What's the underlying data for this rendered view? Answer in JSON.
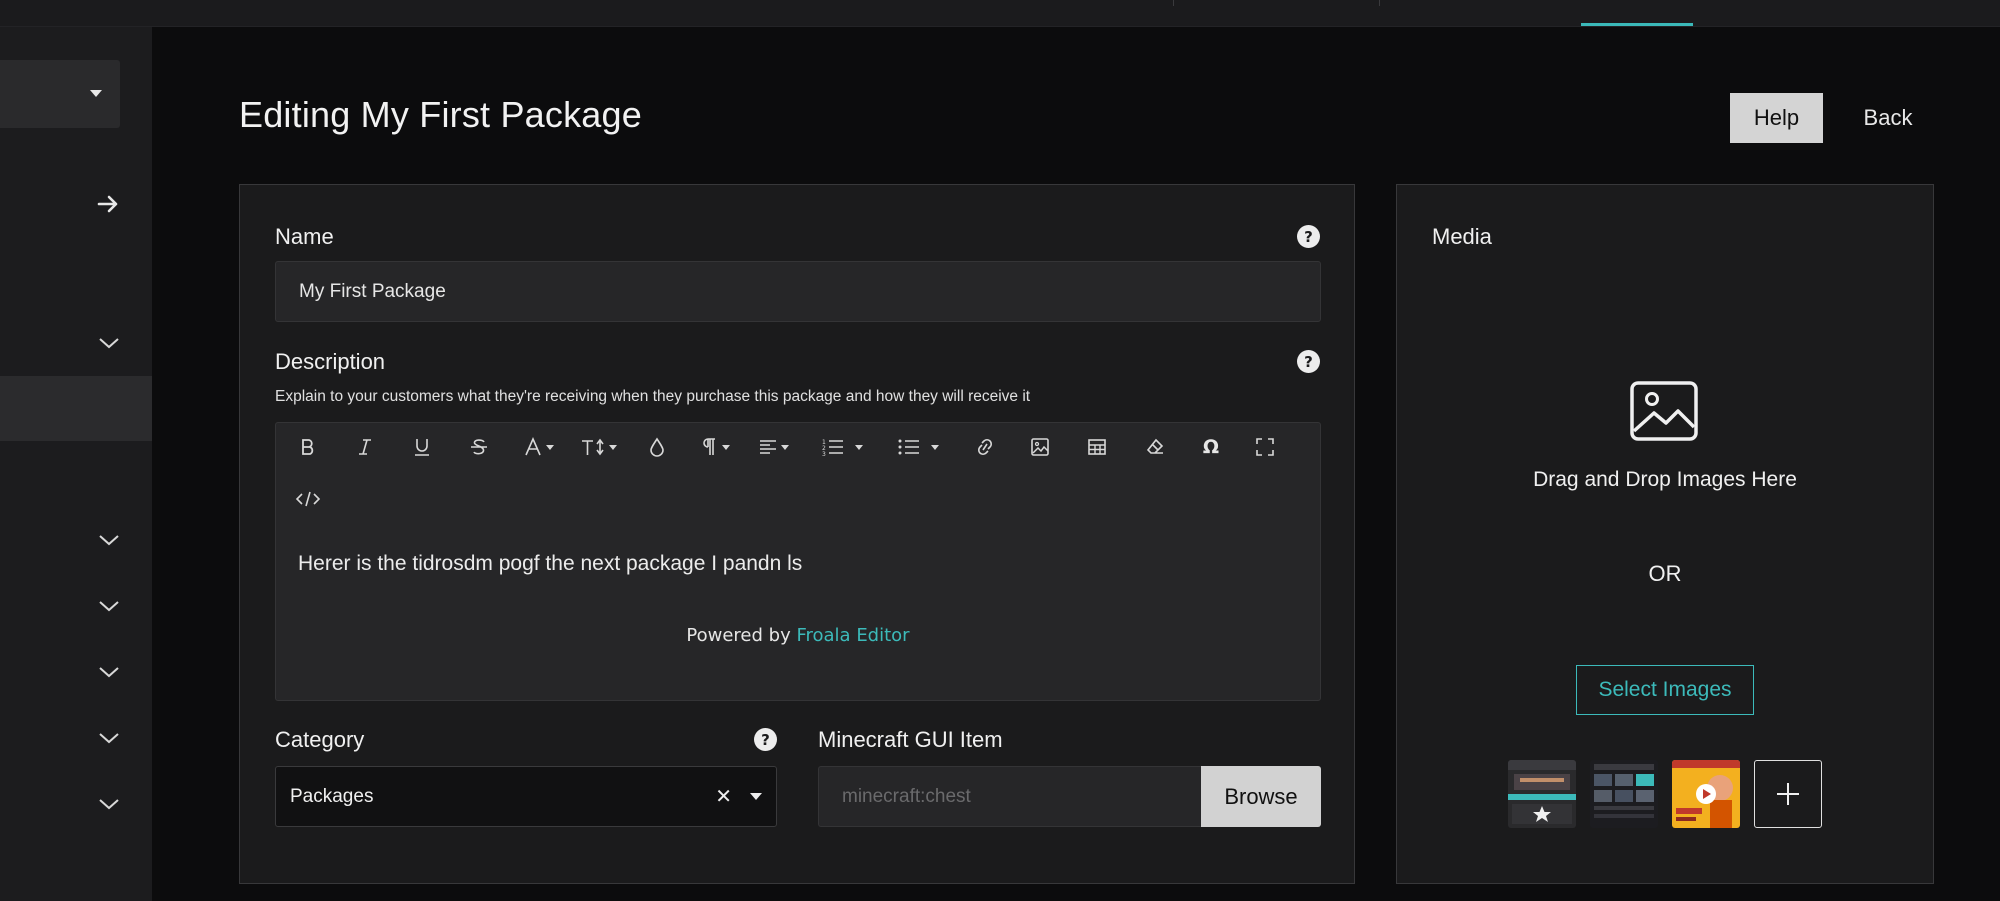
{
  "page": {
    "title": "Editing My First Package",
    "help_label": "Help",
    "back_label": "Back"
  },
  "form": {
    "name": {
      "label": "Name",
      "value": "My First Package"
    },
    "description": {
      "label": "Description",
      "hint": "Explain to your customers what they're receiving when they purchase this package and how they will receive it",
      "content": "Herer is the tidrosdm pogf the next package I pandn ls",
      "powered_prefix": "Powered by ",
      "powered_brand": "Froala Editor",
      "toolbar_icons": [
        "bold-icon",
        "italic-icon",
        "underline-icon",
        "strikethrough-icon",
        "text-color-icon",
        "font-size-icon",
        "color-drop-icon",
        "paragraph-format-icon",
        "align-icon",
        "ordered-list-icon",
        "unordered-list-icon",
        "link-icon",
        "image-icon",
        "table-icon",
        "clear-formatting-icon",
        "special-characters-icon",
        "fullscreen-icon",
        "code-view-icon"
      ],
      "special_char_glyph": "Ω"
    },
    "category": {
      "label": "Category",
      "value": "Packages",
      "clear_glyph": "✕"
    },
    "gui_item": {
      "label": "Minecraft GUI Item",
      "placeholder": "minecraft:chest",
      "browse_label": "Browse"
    }
  },
  "media": {
    "label": "Media",
    "drop_text": "Drag and Drop Images Here",
    "or_text": "OR",
    "select_label": "Select Images",
    "add_glyph": "+"
  },
  "colors": {
    "accent": "#3bb9b9",
    "background": "#0c0c0d",
    "card": "#1b1b1c",
    "sidebar": "#1c1c1e"
  }
}
